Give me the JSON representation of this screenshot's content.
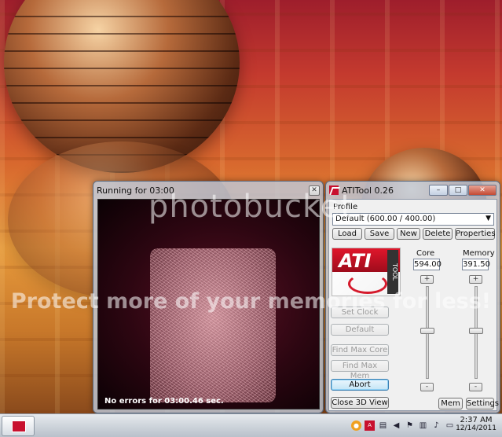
{
  "running_window": {
    "title": "Running for 03:00",
    "status": "No errors for 03:00.46 sec."
  },
  "atitool": {
    "title": "ATITool 0.26",
    "profile_label": "Profile",
    "profile_value": "Default (600.00 / 400.00)",
    "buttons": {
      "load": "Load",
      "save": "Save",
      "new": "New",
      "delete": "Delete",
      "properties": "Properties",
      "set_clock": "Set Clock",
      "default": "Default",
      "find_max_core": "Find Max Core",
      "find_max_mem": "Find Max Mem",
      "abort": "Abort",
      "close_3d_view": "Close 3D View",
      "mem": "Mem",
      "settings": "Settings"
    },
    "core_label": "Core",
    "memory_label": "Memory",
    "core_value": "594.00",
    "memory_value": "391.50",
    "logo_text": "ATI",
    "logo_sub": "TOOL"
  },
  "watermark": {
    "main": "photobucket",
    "sub": "Protect more of your memories for less!"
  },
  "taskbar": {
    "time": "2:37 AM",
    "date": "12/14/2011"
  },
  "colors": {
    "ati_red": "#c8102e",
    "window_glass": "#becde1"
  }
}
